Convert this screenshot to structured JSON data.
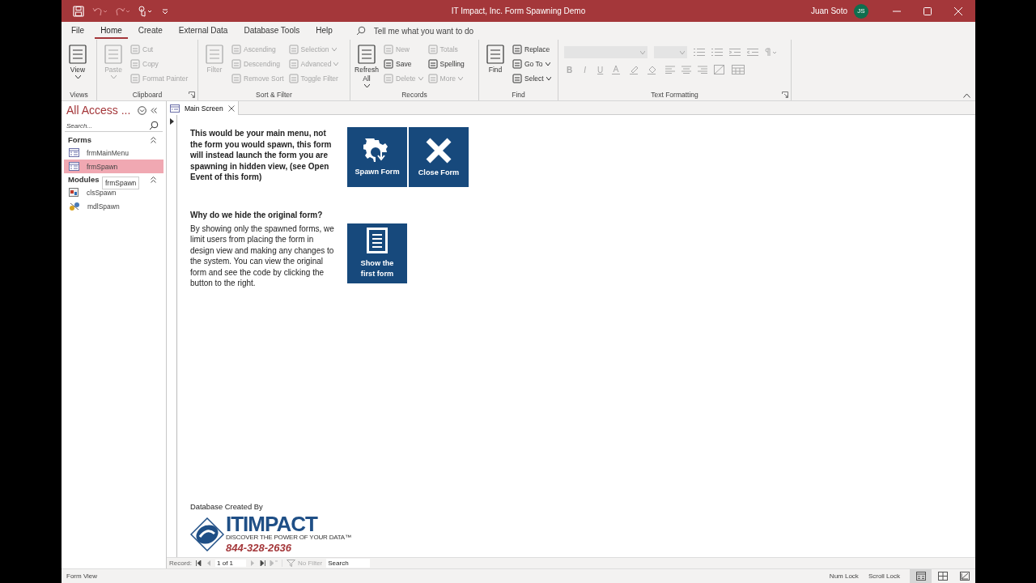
{
  "window": {
    "title": "IT Impact, Inc. Form Spawning Demo",
    "user": "Juan Soto",
    "avatar": "JS"
  },
  "ribbon_tabs": [
    {
      "label": "File",
      "selected": false
    },
    {
      "label": "Home",
      "selected": true
    },
    {
      "label": "Create",
      "selected": false
    },
    {
      "label": "External Data",
      "selected": false
    },
    {
      "label": "Database Tools",
      "selected": false
    },
    {
      "label": "Help",
      "selected": false
    }
  ],
  "tell_me": {
    "placeholder": "Tell me what you want to do"
  },
  "ribbon_groups": [
    {
      "label": "Views",
      "kind": "commands",
      "launcher": false,
      "columns": [
        [
          {
            "label": "View",
            "kind": "large",
            "dropdown": true,
            "disabled": false
          }
        ]
      ]
    },
    {
      "label": "Clipboard",
      "kind": "commands",
      "launcher": true,
      "columns": [
        [
          {
            "label": "Paste",
            "kind": "large",
            "dropdown": true,
            "disabled": true
          }
        ],
        [
          {
            "label": "Cut",
            "kind": "small",
            "dropdown": false,
            "disabled": true
          },
          {
            "label": "Copy",
            "kind": "small",
            "dropdown": false,
            "disabled": true
          },
          {
            "label": "Format Painter",
            "kind": "small",
            "dropdown": false,
            "disabled": true
          }
        ]
      ]
    },
    {
      "label": "Sort & Filter",
      "kind": "commands",
      "launcher": false,
      "columns": [
        [
          {
            "label": "Filter",
            "kind": "large",
            "dropdown": false,
            "disabled": true
          }
        ],
        [
          {
            "label": "Ascending",
            "kind": "small",
            "dropdown": false,
            "disabled": true
          },
          {
            "label": "Descending",
            "kind": "small",
            "dropdown": false,
            "disabled": true
          },
          {
            "label": "Remove Sort",
            "kind": "small",
            "dropdown": false,
            "disabled": true
          }
        ],
        [
          {
            "label": "Selection",
            "kind": "small",
            "dropdown": true,
            "disabled": true
          },
          {
            "label": "Advanced",
            "kind": "small",
            "dropdown": true,
            "disabled": true
          },
          {
            "label": "Toggle Filter",
            "kind": "small",
            "dropdown": false,
            "disabled": true
          }
        ]
      ]
    },
    {
      "label": "Records",
      "kind": "commands",
      "launcher": false,
      "columns": [
        [
          {
            "label": "Refresh All",
            "kind": "large",
            "dropdown": true,
            "disabled": false
          }
        ],
        [
          {
            "label": "New",
            "kind": "small",
            "dropdown": false,
            "disabled": true
          },
          {
            "label": "Save",
            "kind": "small",
            "dropdown": false,
            "disabled": false
          },
          {
            "label": "Delete",
            "kind": "small",
            "dropdown": true,
            "disabled": true
          }
        ],
        [
          {
            "label": "Totals",
            "kind": "small",
            "dropdown": false,
            "disabled": true
          },
          {
            "label": "Spelling",
            "kind": "small",
            "dropdown": false,
            "disabled": false
          },
          {
            "label": "More",
            "kind": "small",
            "dropdown": true,
            "disabled": true
          }
        ]
      ]
    },
    {
      "label": "Find",
      "kind": "commands",
      "launcher": false,
      "columns": [
        [
          {
            "label": "Find",
            "kind": "large",
            "dropdown": false,
            "disabled": false
          }
        ],
        [
          {
            "label": "Replace",
            "kind": "small",
            "dropdown": false,
            "disabled": false
          },
          {
            "label": "Go To",
            "kind": "small",
            "dropdown": true,
            "disabled": false
          },
          {
            "label": "Select",
            "kind": "small",
            "dropdown": true,
            "disabled": false
          }
        ]
      ]
    },
    {
      "label": "Text Formatting",
      "kind": "formatting",
      "launcher": true,
      "format_buttons": [
        "B",
        "I",
        "U"
      ]
    }
  ],
  "navigation": {
    "title": "All Access ...",
    "search": {
      "placeholder": "Search..."
    },
    "groups": [
      {
        "label": "Forms",
        "expanded": true,
        "items": [
          {
            "label": "frmMainMenu",
            "kind": "form",
            "selected": false
          },
          {
            "label": "frmSpawn",
            "kind": "form",
            "selected": true
          }
        ]
      },
      {
        "label": "Modules",
        "expanded": true,
        "items": [
          {
            "label": "clsSpawn",
            "kind": "class",
            "selected": false
          },
          {
            "label": "mdlSpawn",
            "kind": "module",
            "selected": false
          }
        ]
      }
    ],
    "tooltip": "frmSpawn"
  },
  "document_tab": {
    "label": "Main Screen"
  },
  "form": {
    "intro": "This would be your main menu, not the form you would spawn, this form will instead launch the form you are spawning in hidden view, (see Open Event of this form)",
    "buttons": [
      {
        "label": "Spawn Form",
        "kind": "spawn"
      },
      {
        "label": "Close Form",
        "kind": "close"
      }
    ],
    "question": "Why do we hide the original form?",
    "explanation": "By showing only the spawned forms, we limit users from placing the form in design view and making any changes to the system. You can view the original form and see the code by clicking the button to the right.",
    "show_button": {
      "label": "Show the first form",
      "kind": "document"
    },
    "credit": "Database Created By",
    "logo": {
      "name": "ITIMPACT",
      "tagline": "DISCOVER THE POWER OF YOUR DATA™",
      "phone": "844-328-2636"
    }
  },
  "record_navigation": {
    "label": "Record:",
    "position": "1 of 1",
    "filter": "No Filter",
    "search": {
      "placeholder": "Search"
    }
  },
  "status_bar": {
    "mode": "Form View",
    "indicators": [
      "Num Lock",
      "Scroll Lock"
    ],
    "views": [
      {
        "selected": true
      },
      {
        "selected": false
      },
      {
        "selected": false
      }
    ]
  }
}
